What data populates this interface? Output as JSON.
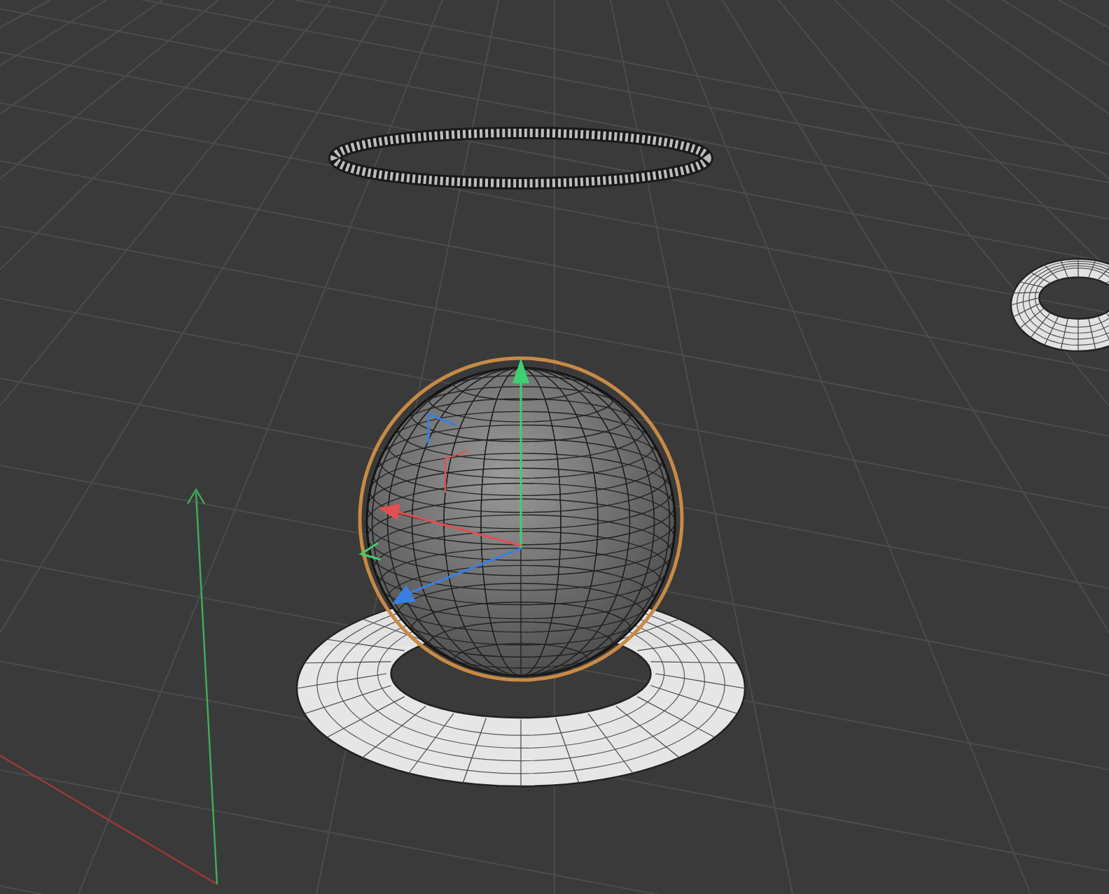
{
  "viewport": {
    "objects": [
      {
        "kind": "ring",
        "selected": false
      },
      {
        "kind": "torus",
        "selected": false
      },
      {
        "kind": "torus",
        "selected": false
      },
      {
        "kind": "sphere",
        "selected": true
      }
    ]
  }
}
